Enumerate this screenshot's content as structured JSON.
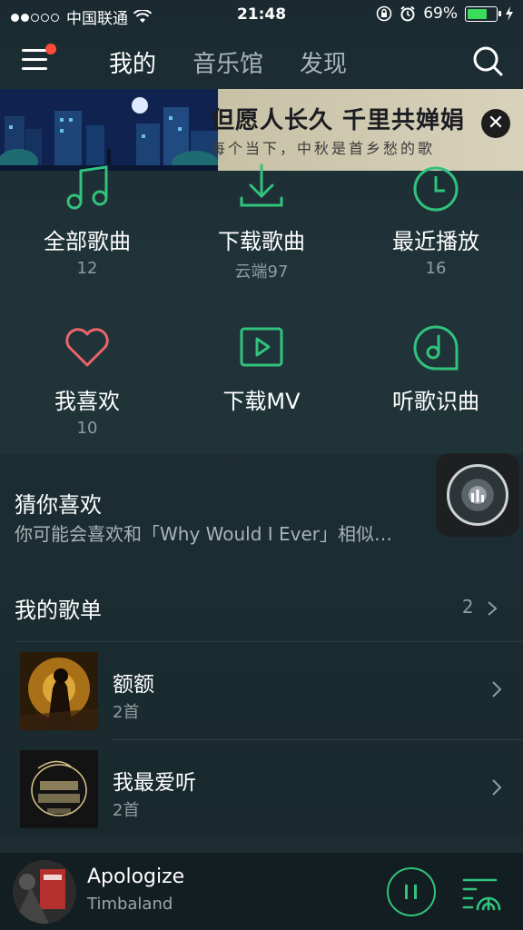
{
  "status": {
    "carrier": "中国联通",
    "time": "21:48",
    "battery": "69%",
    "battery_level": 0.69
  },
  "tabs": [
    {
      "label": "我的"
    },
    {
      "label": "音乐馆"
    },
    {
      "label": "发现"
    }
  ],
  "banner": {
    "title": "但愿人长久 千里共婵娟",
    "subtitle": "每个当下，中秋是首乡愁的歌",
    "close": "✕"
  },
  "grid": [
    {
      "label": "全部歌曲",
      "count": "12",
      "icon": "music-note-icon"
    },
    {
      "label": "下载歌曲",
      "count": "云端97",
      "icon": "download-icon"
    },
    {
      "label": "最近播放",
      "count": "16",
      "icon": "clock-icon"
    },
    {
      "label": "我喜欢",
      "count": "10",
      "icon": "heart-icon"
    },
    {
      "label": "下载MV",
      "count": "",
      "icon": "video-play-icon"
    },
    {
      "label": "听歌识曲",
      "count": "",
      "icon": "recognize-music-icon"
    }
  ],
  "guess": {
    "title": "猜你喜欢",
    "desc": "你可能会喜欢和「Why Would I Ever」相似…"
  },
  "playlists": {
    "title": "我的歌单",
    "count": "2",
    "items": [
      {
        "name": "额额",
        "songs": "2首"
      },
      {
        "name": "我最爱听",
        "songs": "2首"
      }
    ]
  },
  "player": {
    "song": "Apologize",
    "artist": "Timbaland"
  },
  "colors": {
    "accent": "#31c27c",
    "heart": "#e8656a",
    "badge": "#ff4a3a"
  }
}
